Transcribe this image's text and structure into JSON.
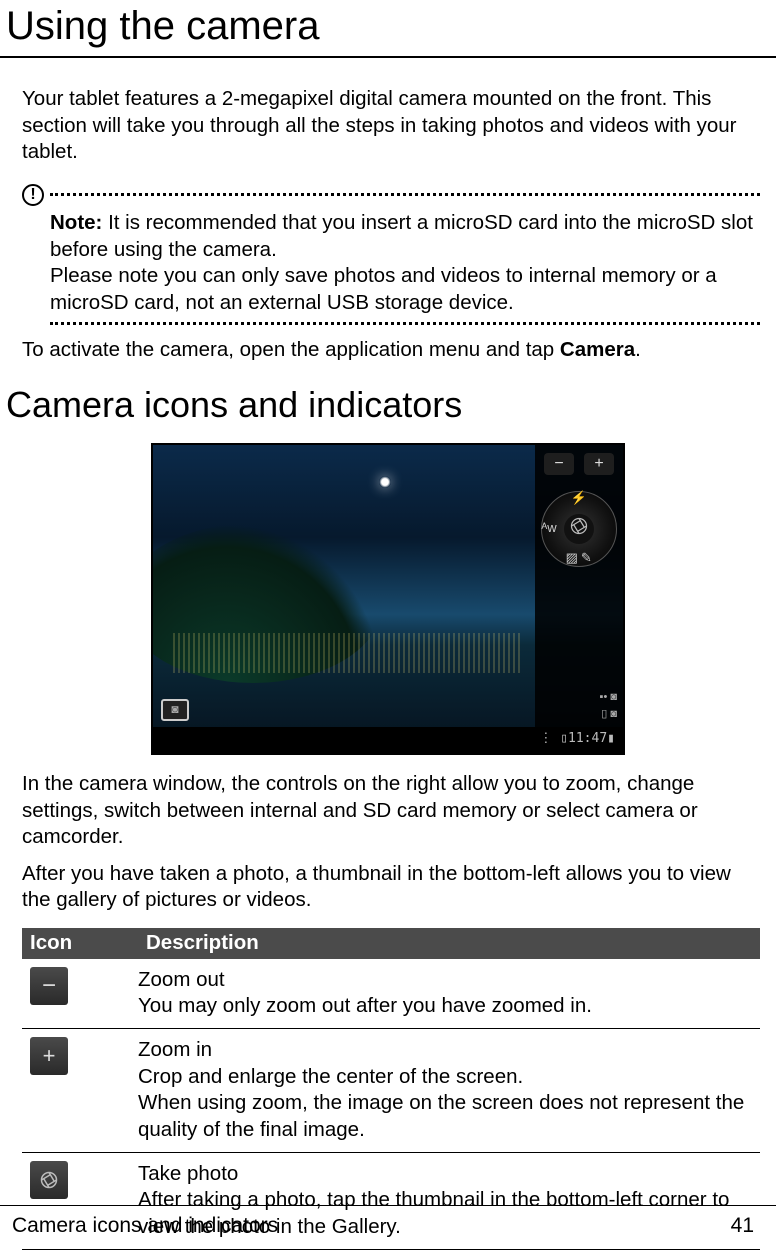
{
  "title": "Using the camera",
  "intro": "Your tablet features a 2-megapixel digital camera mounted on the front. This section will take you through all the steps in taking photos and videos with your tablet.",
  "note": {
    "label": "Note:",
    "line1": " It is recommended that you insert a microSD card into the microSD slot before using the camera.",
    "line2": "Please note you can only save photos and videos to internal memory or a microSD card, not an external USB storage device."
  },
  "activate_pre": "To activate the camera, open the application menu and tap ",
  "activate_bold": "Camera",
  "activate_post": ".",
  "section2": "Camera icons and indicators",
  "paragraphs": {
    "p1": "In the camera window, the controls on the right allow you to zoom, change settings, switch between internal and SD card memory or select camera or camcorder.",
    "p2": "After you have taken a photo, a thumbnail in the bottom-left allows you to view the gallery of pictures or videos."
  },
  "table_headers": {
    "icon": "Icon",
    "desc": "Description"
  },
  "table_rows": [
    {
      "icon_name": "zoom-out-icon",
      "glyph": "−",
      "title": "Zoom out",
      "lines": [
        "You may only zoom out after you have zoomed in."
      ]
    },
    {
      "icon_name": "zoom-in-icon",
      "glyph": "+",
      "title": "Zoom in",
      "lines": [
        "Crop and enlarge the center of the screen.",
        "When using zoom, the image on the screen does not represent the quality of the final image."
      ]
    },
    {
      "icon_name": "take-photo-icon",
      "glyph": "aperture",
      "title": "Take photo",
      "lines": [
        "After taking a photo, tap the thumbnail in the bottom-left corner to view the photo in the Gallery."
      ]
    }
  ],
  "screenshot": {
    "zoom_out_glyph": "−",
    "zoom_in_glyph": "+",
    "status_time": "11:47",
    "wheel_icons": {
      "top": "⚡",
      "left": "ᴬw",
      "bottom": "▨",
      "right_settings": "✎"
    }
  },
  "footer": {
    "left": "Camera icons and indicators",
    "right": "41"
  }
}
